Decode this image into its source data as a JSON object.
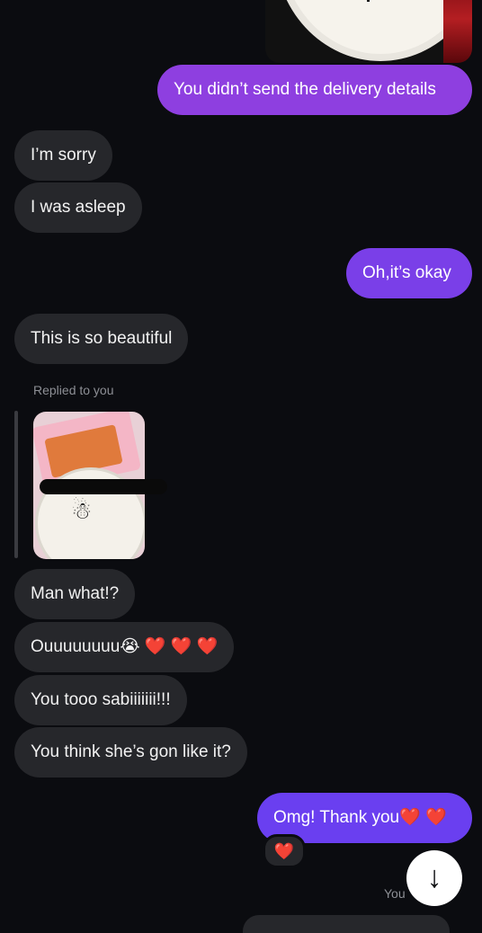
{
  "colors": {
    "background": "#0b0c10",
    "incoming_bubble": "#26272b",
    "outgoing_purple": "#8e3fe0",
    "outgoing_violet": "#6a3ff0",
    "heart": "#e0342a"
  },
  "messages": [
    {
      "side": "out",
      "text": "You didn’t send the delivery details"
    },
    {
      "side": "in",
      "text": "I’m sorry"
    },
    {
      "side": "in",
      "text": "I was asleep"
    },
    {
      "side": "out",
      "text": "Oh,it’s okay"
    },
    {
      "side": "in",
      "text": "This is so beautiful"
    },
    {
      "side": "in",
      "text": "Man what!?"
    },
    {
      "side": "in",
      "text": "Ouuuuuuuu",
      "emoji": "😭",
      "hearts": "❤️ ❤️ ❤️"
    },
    {
      "side": "in",
      "text": "You tooo sabiiiiiii!!!"
    },
    {
      "side": "in",
      "text": "You think she’s gon like it?"
    },
    {
      "side": "out",
      "text": "Omg! Thank you",
      "hearts": "❤️ ❤️"
    }
  ],
  "reply": {
    "label": "Replied to you",
    "image_caption_icon": "cake-photo"
  },
  "reaction": {
    "emoji": "❤️"
  },
  "scroll_button": {
    "icon": "arrow-down-icon",
    "glyph": "↓"
  },
  "seen_label": "You"
}
